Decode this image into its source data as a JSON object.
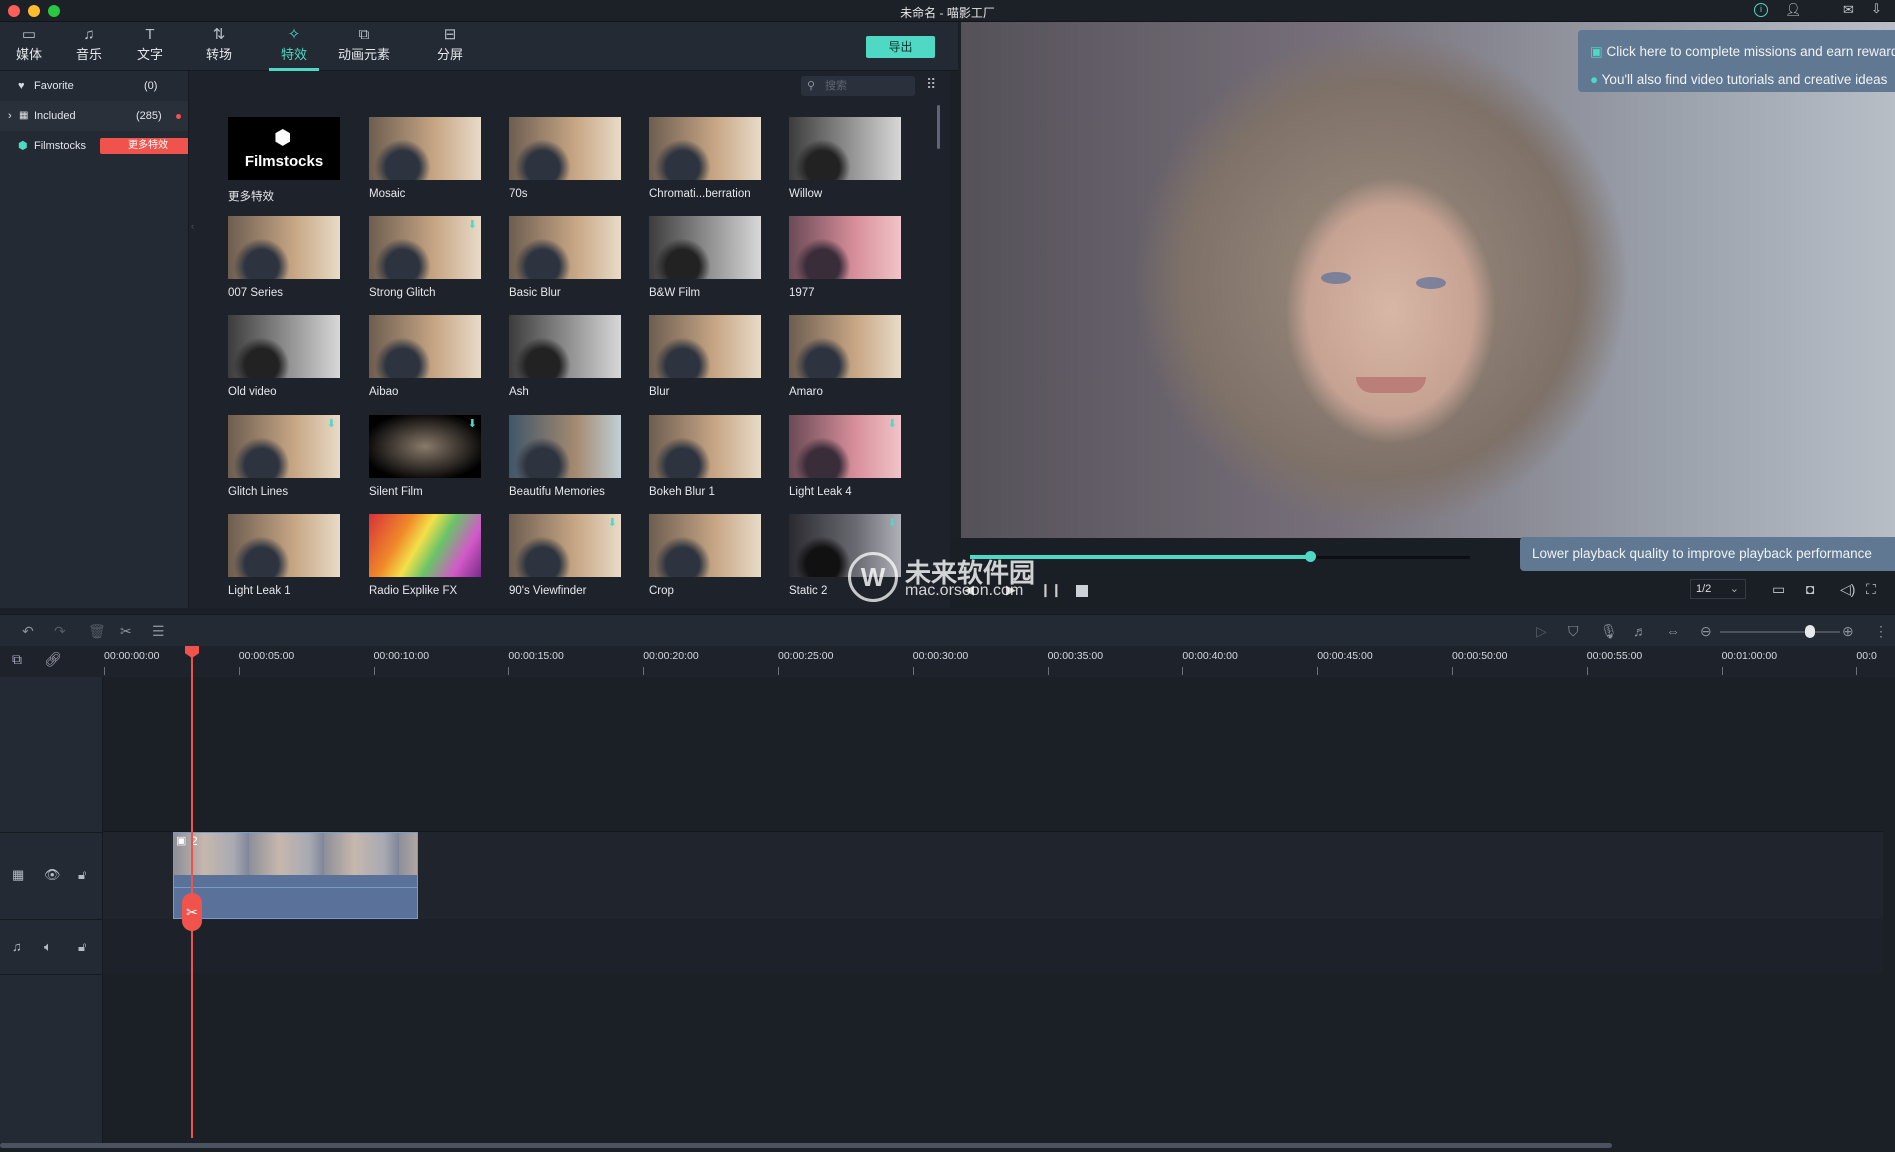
{
  "window": {
    "title": "未命名 - 喵影工厂"
  },
  "toolbar": {
    "tabs": [
      {
        "label": "媒体",
        "icon": "folder-icon"
      },
      {
        "label": "音乐",
        "icon": "music-note-icon"
      },
      {
        "label": "文字",
        "icon": "text-icon"
      },
      {
        "label": "转场",
        "icon": "transition-icon"
      },
      {
        "label": "特效",
        "icon": "effects-icon",
        "active": true
      },
      {
        "label": "动画元素",
        "icon": "elements-icon"
      },
      {
        "label": "分屏",
        "icon": "split-screen-icon"
      }
    ],
    "export_label": "导出"
  },
  "sidebar": {
    "items": [
      {
        "label": "Favorite",
        "count": "(0)"
      },
      {
        "label": "Included",
        "count": "(285)"
      },
      {
        "label": "Filmstocks",
        "badge": "更多特效"
      }
    ]
  },
  "search": {
    "placeholder": "搜索"
  },
  "effects": [
    {
      "label": "更多特效",
      "style": "logo",
      "logo_text": "Filmstocks"
    },
    {
      "label": "Mosaic"
    },
    {
      "label": "70s"
    },
    {
      "label": "Chromati...berration"
    },
    {
      "label": "Willow",
      "style": "gray"
    },
    {
      "label": "007 Series"
    },
    {
      "label": "Strong Glitch",
      "download": true
    },
    {
      "label": "Basic Blur"
    },
    {
      "label": "B&W Film",
      "style": "gray"
    },
    {
      "label": "1977",
      "style": "pink"
    },
    {
      "label": "Old video",
      "style": "gray"
    },
    {
      "label": "Aibao"
    },
    {
      "label": "Ash",
      "style": "gray"
    },
    {
      "label": "Blur"
    },
    {
      "label": "Amaro"
    },
    {
      "label": "Glitch Lines",
      "download": true
    },
    {
      "label": "Silent Film",
      "download": true,
      "style": "vignette"
    },
    {
      "label": "Beautifu Memories",
      "style": "blue"
    },
    {
      "label": "Bokeh Blur 1"
    },
    {
      "label": "Light Leak 4",
      "download": true,
      "style": "pink"
    },
    {
      "label": "Light Leak 1"
    },
    {
      "label": "Radio Explike FX",
      "style": "rainbow"
    },
    {
      "label": "90's Viewfinder",
      "download": true
    },
    {
      "label": "Crop"
    },
    {
      "label": "Static 2",
      "download": true,
      "style": "dark"
    }
  ],
  "notifications": {
    "missions": "Click here to complete missions and earn rewards",
    "tutorials": "You'll also find video tutorials and creative ideas"
  },
  "playback": {
    "progress": 0.34,
    "quality": "1/2",
    "tooltip": "Lower playback quality to improve playback performance"
  },
  "watermark": {
    "title": "未来软件园",
    "url": "mac.orsoon.com"
  },
  "timeline": {
    "ticks": [
      "00:00:00:00",
      "00:00:05:00",
      "00:00:10:00",
      "00:00:15:00",
      "00:00:20:00",
      "00:00:25:00",
      "00:00:30:00",
      "00:00:35:00",
      "00:00:40:00",
      "00:00:45:00",
      "00:00:50:00",
      "00:00:55:00",
      "00:01:00:00",
      "00:0"
    ],
    "zoom_level": 0.75,
    "clip_label": "2"
  },
  "colors": {
    "accent": "#4fd8c4",
    "playhead": "#f0524c",
    "badge": "#f0524c",
    "clip": "#5a7299"
  }
}
